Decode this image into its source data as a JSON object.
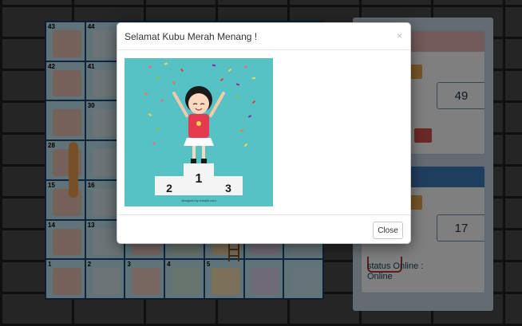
{
  "board": {
    "cells": [
      {
        "number": "43"
      },
      {
        "number": "44"
      },
      {
        "number": ""
      },
      {
        "number": ""
      },
      {
        "number": ""
      },
      {
        "number": ""
      },
      {
        "number": ""
      },
      {
        "number": "42"
      },
      {
        "number": "41"
      },
      {
        "number": ""
      },
      {
        "number": ""
      },
      {
        "number": ""
      },
      {
        "number": ""
      },
      {
        "number": ""
      },
      {
        "number": ""
      },
      {
        "number": "30"
      },
      {
        "number": ""
      },
      {
        "number": ""
      },
      {
        "number": ""
      },
      {
        "number": ""
      },
      {
        "number": ""
      },
      {
        "number": "28"
      },
      {
        "number": ""
      },
      {
        "number": ""
      },
      {
        "number": ""
      },
      {
        "number": ""
      },
      {
        "number": ""
      },
      {
        "number": ""
      },
      {
        "number": "15"
      },
      {
        "number": "16"
      },
      {
        "number": ""
      },
      {
        "number": ""
      },
      {
        "number": ""
      },
      {
        "number": ""
      },
      {
        "number": ""
      },
      {
        "number": "14"
      },
      {
        "number": "13"
      },
      {
        "number": ""
      },
      {
        "number": ""
      },
      {
        "number": ""
      },
      {
        "number": ""
      },
      {
        "number": ""
      },
      {
        "number": "1"
      },
      {
        "number": "2"
      },
      {
        "number": "3"
      },
      {
        "number": "4"
      },
      {
        "number": "5"
      },
      {
        "number": ""
      },
      {
        "number": ""
      }
    ]
  },
  "players": {
    "red": {
      "score": "49",
      "head_color": "#e8a0a0",
      "accent": "#d9534f"
    },
    "blue": {
      "score": "17",
      "head_color": "#3f7fbf"
    },
    "status_text": "status Online :",
    "status_value": "Online"
  },
  "modal": {
    "title": "Selamat Kubu Merah Menang !",
    "close_x": "×",
    "close_button": "Close",
    "podium": {
      "first": "1",
      "second": "2",
      "third": "3"
    },
    "credit": "designed by freepik.com"
  },
  "colors": {
    "accent_blue": "#2f6fae",
    "modal_bg_teal": "#56c2c4"
  }
}
